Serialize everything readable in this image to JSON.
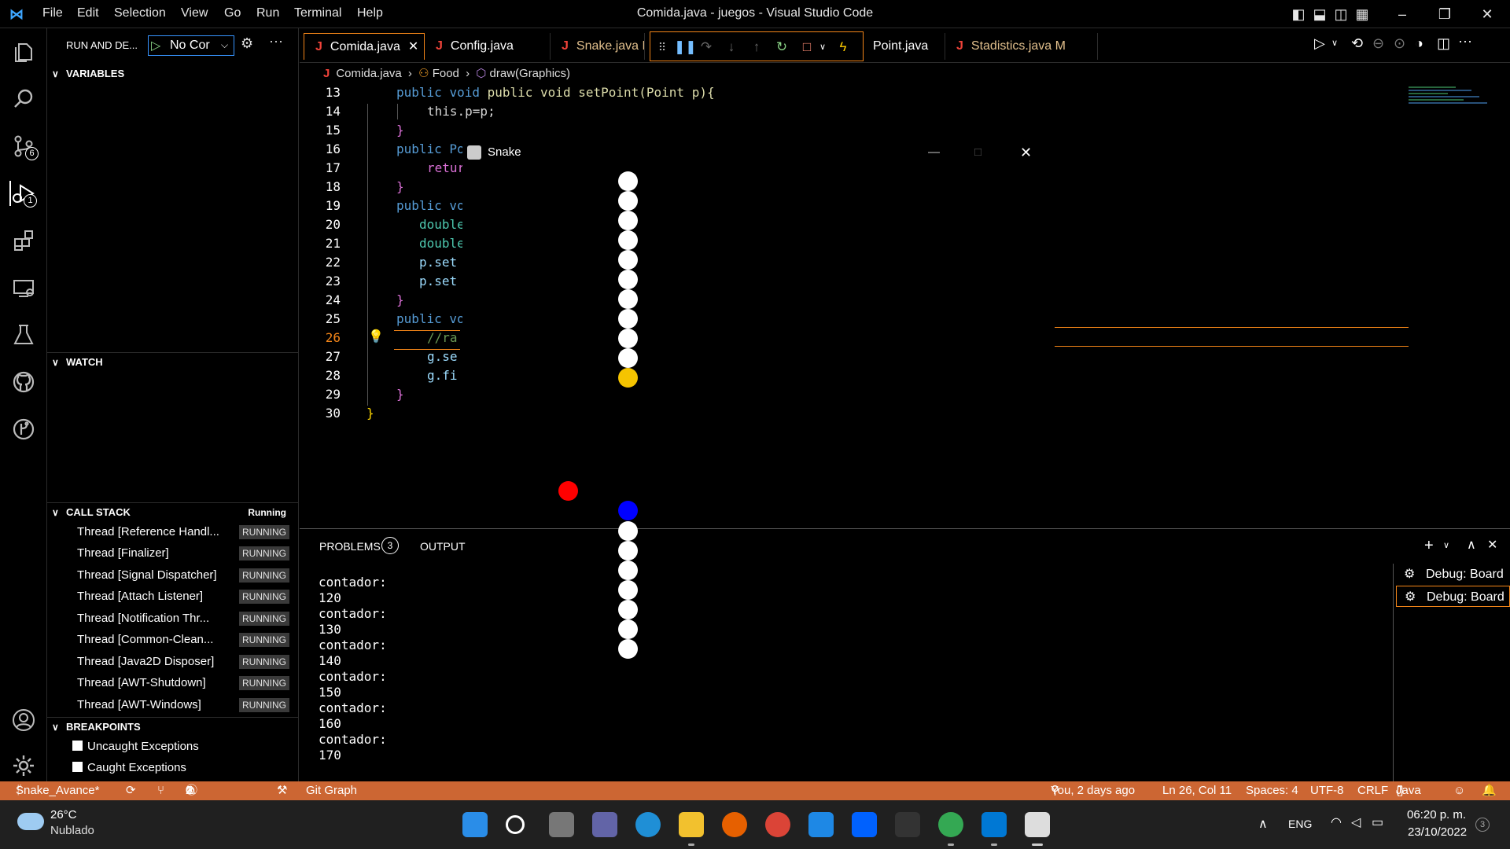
{
  "window": {
    "title": "Comida.java - juegos - Visual Studio Code",
    "menu": [
      "File",
      "Edit",
      "Selection",
      "View",
      "Go",
      "Run",
      "Terminal",
      "Help"
    ]
  },
  "activity_bar": {
    "items": [
      {
        "name": "explorer-icon"
      },
      {
        "name": "search-icon"
      },
      {
        "name": "source-control-icon",
        "badge": "6"
      },
      {
        "name": "run-debug-icon",
        "badge": "1"
      },
      {
        "name": "extensions-icon"
      },
      {
        "name": "remote-explorer-icon"
      },
      {
        "name": "testing-icon"
      },
      {
        "name": "github-icon"
      },
      {
        "name": "git-graph-icon"
      },
      {
        "name": "account-icon"
      },
      {
        "name": "settings-gear-icon"
      }
    ]
  },
  "sidebar": {
    "header": "RUN AND DE...",
    "config_select": "No Cor",
    "sections": {
      "variables": "VARIABLES",
      "watch": "WATCH",
      "call_stack": "CALL STACK",
      "call_stack_status": "Running",
      "breakpoints": "BREAKPOINTS"
    },
    "threads": [
      {
        "name": "Thread [Reference Handl...",
        "state": "RUNNING"
      },
      {
        "name": "Thread [Finalizer]",
        "state": "RUNNING"
      },
      {
        "name": "Thread [Signal Dispatcher]",
        "state": "RUNNING"
      },
      {
        "name": "Thread [Attach Listener]",
        "state": "RUNNING"
      },
      {
        "name": "Thread [Notification Thr...",
        "state": "RUNNING"
      },
      {
        "name": "Thread [Common-Clean...",
        "state": "RUNNING"
      },
      {
        "name": "Thread [Java2D Disposer]",
        "state": "RUNNING"
      },
      {
        "name": "Thread [AWT-Shutdown]",
        "state": "RUNNING"
      },
      {
        "name": "Thread [AWT-Windows]",
        "state": "RUNNING"
      }
    ],
    "breakpoints": [
      "Uncaught Exceptions",
      "Caught Exceptions"
    ]
  },
  "tabs": [
    {
      "label": "Comida.java",
      "active": true
    },
    {
      "label": "Config.java"
    },
    {
      "label": "Snake.java M"
    },
    {
      "label": "Point.java"
    },
    {
      "label": "Stadistics.java",
      "status": "M"
    }
  ],
  "breadcrumb": [
    "Comida.java",
    "Food",
    "draw(Graphics)"
  ],
  "editor": {
    "line_numbers": [
      "13",
      "14",
      "15",
      "16",
      "17",
      "18",
      "19",
      "20",
      "21",
      "22",
      "23",
      "24",
      "25",
      "26",
      "27",
      "28",
      "29",
      "30"
    ],
    "current_line": "26",
    "lines": [
      "public void setPoint(Point p){",
      "this.p=p;",
      "}",
      "public Po",
      "retur",
      "}",
      "public vo",
      "double",
      "double",
      "p.set",
      "p.set",
      "}",
      "public vo",
      "//ra",
      "g.se",
      "g.fi",
      "}",
      "}"
    ]
  },
  "snake_window": {
    "title": "Snake",
    "colors": {
      "body": "#ffffff",
      "head_top": "#f5c400",
      "head_bottom": "#0000ff",
      "food": "#ff0000"
    }
  },
  "panel": {
    "tabs": {
      "problems": "PROBLEMS",
      "problems_count": "3",
      "output": "OUTPUT"
    },
    "output_lines": [
      "contador:",
      "120",
      "contador:",
      "130",
      "contador:",
      "140",
      "contador:",
      "150",
      "contador:",
      "160",
      "contador:",
      "170"
    ],
    "terminals": [
      "Debug: Board",
      "Debug: Board"
    ]
  },
  "status_bar": {
    "branch": "Snake_Avance*",
    "errors": "0",
    "warnings": "1",
    "info": "2",
    "git_graph": "Git Graph",
    "blame": "You, 2 days ago",
    "position": "Ln 26, Col 11",
    "spaces": "Spaces: 4",
    "encoding": "UTF-8",
    "eol": "CRLF",
    "language": "Java"
  },
  "taskbar": {
    "weather_temp": "26°C",
    "weather_desc": "Nublado",
    "language": "ENG",
    "time": "06:20 p. m.",
    "date": "23/10/2022",
    "notifications": "3"
  }
}
